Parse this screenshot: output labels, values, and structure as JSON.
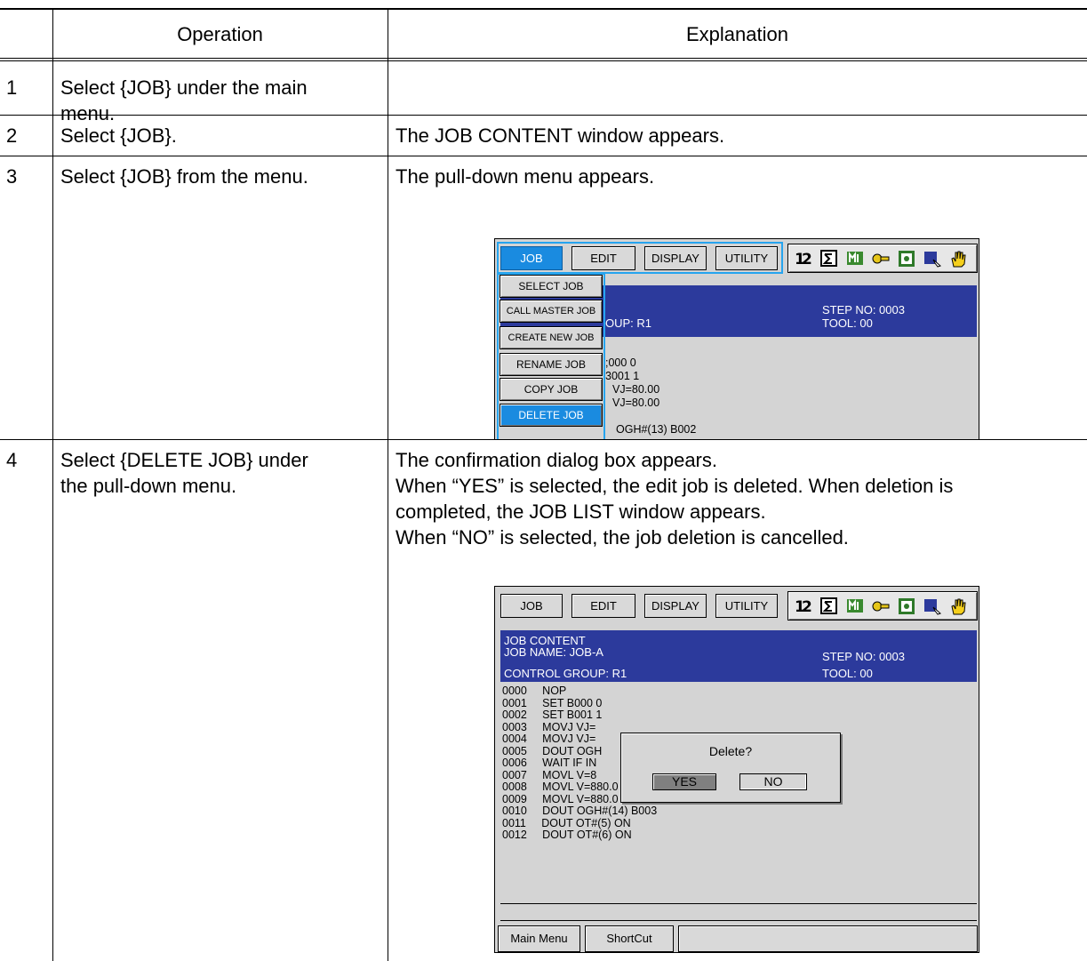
{
  "table": {
    "headers": {
      "operation": "Operation",
      "explanation": "Explanation"
    },
    "rows": [
      {
        "num": "1",
        "operation": [
          "Select {JOB} under the main",
          "menu."
        ],
        "explanation": []
      },
      {
        "num": "2",
        "operation": [
          "Select {JOB}."
        ],
        "explanation": [
          "The JOB CONTENT window appears."
        ]
      },
      {
        "num": "3",
        "operation": [
          "Select {JOB} from the menu."
        ],
        "explanation": [
          "The pull-down menu appears."
        ]
      },
      {
        "num": "4",
        "operation": [
          "Select {DELETE JOB} under",
          "the pull-down menu."
        ],
        "explanation": [
          "The confirmation dialog box appears.",
          "When “YES” is selected, the edit job is deleted.  When deletion is",
          "completed, the JOB LIST window appears.",
          "When “NO” is selected, the job deletion is cancelled."
        ]
      }
    ]
  },
  "menubar": {
    "job": "JOB",
    "edit": "EDIT",
    "display": "DISPLAY",
    "utility": "UTILITY"
  },
  "icons": [
    "language-icon",
    "sigma-icon",
    "memory-icon",
    "key-icon",
    "teach-icon",
    "cursor-icon",
    "hand-icon"
  ],
  "screen1": {
    "dropdown": [
      "SELECT JOB",
      "CALL MASTER JOB",
      "CREATE NEW JOB",
      "RENAME JOB",
      "COPY JOB",
      "DELETE JOB"
    ],
    "header": {
      "step": "STEP NO: 0003",
      "group": "OUP: R1",
      "tool": "TOOL: 00"
    },
    "lines": [
      "                                           "
    ],
    "visible_lines": [
      ";000 0",
      "3001 1",
      "VJ=80.00",
      "VJ=80.00",
      "OGH#(13) B002"
    ]
  },
  "screen2": {
    "header": {
      "title": "JOB CONTENT",
      "job_name": "JOB NAME: JOB-A",
      "group": "CONTROL GROUP: R1",
      "step": "STEP NO: 0003",
      "tool": "TOOL: 00"
    },
    "lines": [
      "0000     NOP",
      "0001     SET B000 0",
      "0002     SET B001 1",
      "0003     MOVJ VJ=",
      "0004     MOVJ VJ=",
      "0005     DOUT OGH",
      "0006     WAIT IF IN",
      "0007     MOVL V=8",
      "0008     MOVL V=880.0",
      "0009     MOVL V=880.0",
      "0010     DOUT OGH#(14) B003",
      "0011     DOUT OT#(5) ON",
      "0012     DOUT OT#(6) ON"
    ],
    "dialog": {
      "message": "Delete?",
      "yes": "YES",
      "no": "NO"
    },
    "bottom": {
      "main_menu": "Main Menu",
      "shortcut": "ShortCut"
    }
  }
}
